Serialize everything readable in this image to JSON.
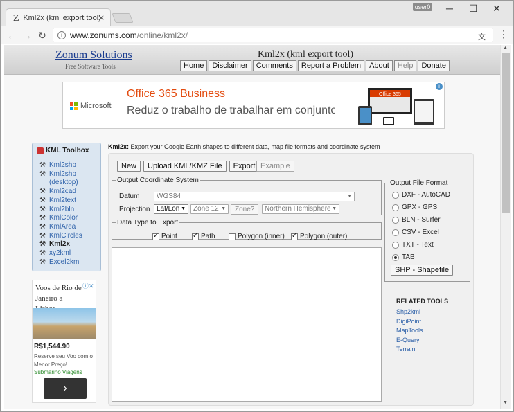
{
  "browser": {
    "tab_title": "Kml2x (kml export tool)",
    "tab_icon": "Z",
    "user_badge": "user0",
    "url_host": "www.zonums.com",
    "url_path": "/online/kml2x/"
  },
  "header": {
    "brand": "Zonum Solutions",
    "brand_sub": "Free Software Tools",
    "title": "Kml2x (kml export tool)",
    "nav": [
      "Home",
      "Disclaimer",
      "Comments",
      "Report a Problem",
      "About",
      "Help",
      "Donate"
    ]
  },
  "ad_top": {
    "brand": "Microsoft",
    "headline": "Office 365 Business",
    "text": "Reduz o trabalho de trabalhar em conjunto",
    "badge": "Office 365"
  },
  "toolbox": {
    "title": "KML Toolbox",
    "items": [
      "Kml2shp",
      "Kml2shp (desktop)",
      "Kml2cad",
      "Kml2text",
      "Kml2bln",
      "KmlColor",
      "KmlArea",
      "KmlCircles",
      "Kml2x",
      "xy2kml",
      "Excel2kml"
    ],
    "current": "Kml2x"
  },
  "ad_side": {
    "title": "Voos de Rio de Janeiro a Lisboa",
    "price": "R$1,544.90",
    "desc": "Reserve seu Voo com o Menor Preço!",
    "source": "Submarino Viagens"
  },
  "main": {
    "intro_bold": "Kml2x:",
    "intro": "Export your Google Earth shapes to different data, map file formats and coordinate system",
    "buttons": {
      "new": "New",
      "upload": "Upload KML/KMZ File",
      "export": "Export",
      "example": "Example"
    },
    "coord": {
      "legend": "Output Coordinate System",
      "datum_label": "Datum",
      "datum_value": "WGS84",
      "projection_label": "Projection",
      "projection_value": "Lat/Lon",
      "zone_value": "Zone 12",
      "zone_button": "Zone?",
      "hemisphere_value": "Northern Hemisphere"
    },
    "datatype": {
      "legend": "Data Type to Export",
      "options": [
        {
          "label": "Point",
          "checked": true
        },
        {
          "label": "Path",
          "checked": true
        },
        {
          "label": "Polygon (inner)",
          "checked": false
        },
        {
          "label": "Polygon (outer)",
          "checked": true
        }
      ]
    },
    "format": {
      "legend": "Output File Format",
      "options": [
        {
          "label": "DXF - AutoCAD",
          "selected": false
        },
        {
          "label": "GPX - GPS",
          "selected": false
        },
        {
          "label": "BLN - Surfer",
          "selected": false
        },
        {
          "label": "CSV - Excel",
          "selected": false
        },
        {
          "label": "TXT - Text",
          "selected": false
        },
        {
          "label": "TAB",
          "selected": true
        }
      ],
      "shp_button": "SHP - Shapefile"
    },
    "related": {
      "heading": "RELATED TOOLS",
      "links": [
        "Shp2kml",
        "DigiPoint",
        "MapTools",
        "E-Query",
        "Terrain"
      ]
    }
  }
}
